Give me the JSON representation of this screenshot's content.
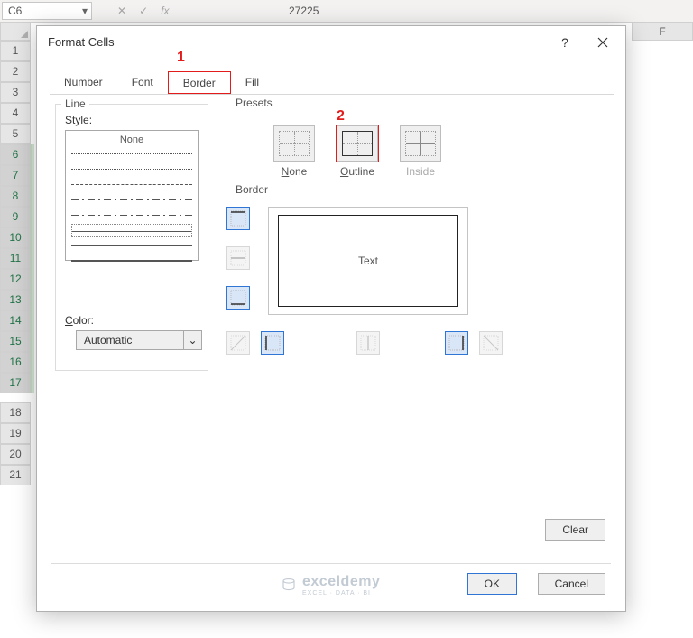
{
  "formula_bar": {
    "name_box": "C6",
    "fx_label": "fx",
    "formula_value": "27225"
  },
  "sheet": {
    "col_f": "F",
    "rows_visible": [
      "1",
      "2",
      "3",
      "4",
      "5",
      "6",
      "7",
      "8",
      "9",
      "10",
      "11",
      "12",
      "13",
      "14",
      "15",
      "16",
      "17"
    ],
    "rows_after_gap": [
      "18",
      "19",
      "20",
      "21"
    ],
    "selected_range_rows": [
      "6",
      "7",
      "8",
      "9",
      "10",
      "11",
      "12",
      "13",
      "14",
      "15",
      "16",
      "17"
    ]
  },
  "dialog": {
    "title": "Format Cells",
    "help": "?",
    "tabs": {
      "number": "Number",
      "font": "Font",
      "border": "Border",
      "fill": "Fill",
      "selected": "border"
    },
    "annotations": {
      "ann1": "1",
      "ann2": "2"
    },
    "line_group": {
      "legend": "Line",
      "style_label": "Style:",
      "none_option": "None",
      "color_label": "Color:",
      "color_value": "Automatic"
    },
    "presets_group": {
      "legend": "Presets",
      "none": "None",
      "outline": "Outline",
      "inside": "Inside"
    },
    "border_group": {
      "legend": "Border",
      "preview_text": "Text"
    },
    "buttons": {
      "clear": "Clear",
      "ok": "OK",
      "cancel": "Cancel"
    }
  },
  "watermark": {
    "brand": "exceldemy",
    "tagline": "EXCEL · DATA · BI"
  }
}
